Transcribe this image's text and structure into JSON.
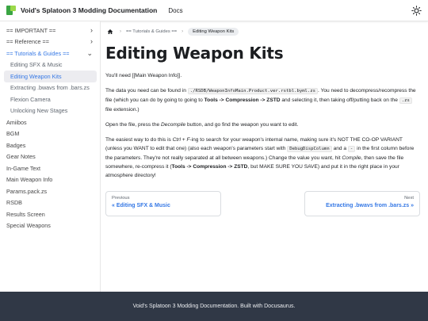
{
  "navbar": {
    "title": "Void's Splatoon 3 Modding Documentation",
    "docs_link": "Docs",
    "theme_icon": "sun-icon"
  },
  "sidebar": {
    "items": [
      {
        "label": "== IMPORTANT ==",
        "chevron": "›"
      },
      {
        "label": "== Reference ==",
        "chevron": "›"
      },
      {
        "label": "== Tutorials & Guides ==",
        "chevron": "⌄"
      },
      {
        "label": "Editing SFX & Music"
      },
      {
        "label": "Editing Weapon Kits"
      },
      {
        "label": "Extracting .bwavs from .bars.zs"
      },
      {
        "label": "Flexion Camera"
      },
      {
        "label": "Unlocking New Stages"
      },
      {
        "label": "Amiibos"
      },
      {
        "label": "BGM"
      },
      {
        "label": "Badges"
      },
      {
        "label": "Gear Notes"
      },
      {
        "label": "In-Game Text"
      },
      {
        "label": "Main Weapon Info"
      },
      {
        "label": "Params.pack.zs"
      },
      {
        "label": "RSDB"
      },
      {
        "label": "Results Screen"
      },
      {
        "label": "Special Weapons"
      }
    ]
  },
  "breadcrumb": {
    "home_icon": "home-icon",
    "separator": "›",
    "category": "== Tutorials & Guides ==",
    "current": "Editing Weapon Kits"
  },
  "article": {
    "title": "Editing Weapon Kits",
    "p1": "You'll need [[Main Weapon Info]].",
    "p2": {
      "a": "The data you need can be found in ",
      "code1": "./RSDB/WeaponInfoMain.Product.ver.rstbl.byml.zs",
      "b": ". You need to decompress/recompress the file (which you can do by going to going to ",
      "bold1": "Tools -> Compression -> ZSTD",
      "c": " and selecting it, then taking off/putting back on the ",
      "code2": ".zs",
      "d": " file extension.)"
    },
    "p3": {
      "a": "Open the file, press the ",
      "italic1": "Decompile",
      "b": " button, and go find the weapon you want to edit."
    },
    "p4": {
      "a": "The easiest way to do this is ",
      "italic1": "Ctrl + F",
      "b": "-ing to search for your weapon's internal name, making sure it's NOT THE CO-OP VARIANT (unless you WANT to edit that one) (also each weapon's parameters start with ",
      "code1": "DebugDispColumn",
      "c": " and a ",
      "code2": "-",
      "d": " in the first column before the parameters. They're not really separated at all between weapons.) Change the value you want, hit ",
      "italic2": "Compile",
      "e": ", then save the file somewhere, re-compress it (",
      "bold1": "Tools -> Compression -> ZSTD",
      "f": ", but MAKE SURE YOU SAVE) and put it in the right place in your atmosphere directory!"
    }
  },
  "pager": {
    "prev_label": "Previous",
    "prev_title": "« Editing SFX & Music",
    "next_label": "Next",
    "next_title": "Extracting .bwavs from .bars.zs »"
  },
  "footer": {
    "text": "Void's Splatoon 3 Modding Documentation. Built with Docusaurus."
  }
}
